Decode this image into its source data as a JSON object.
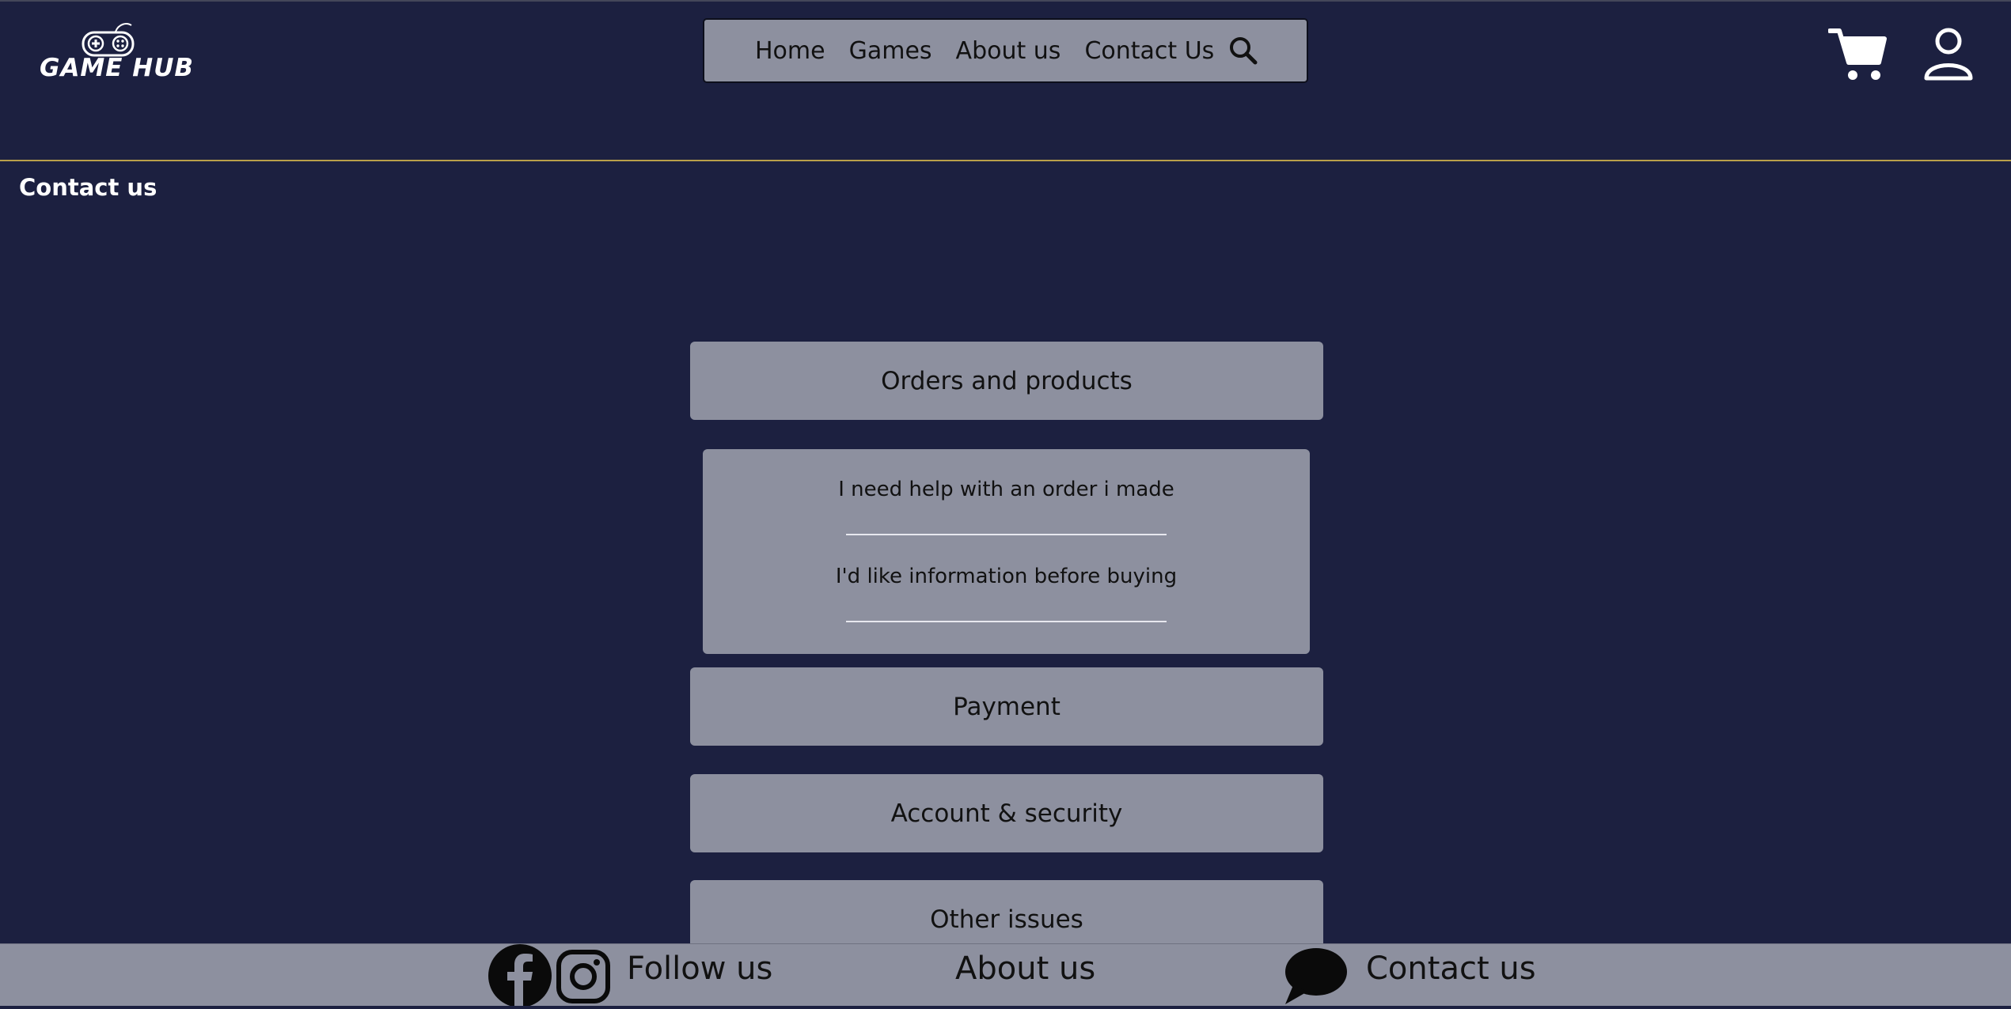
{
  "brand": {
    "name": "GAME HUB"
  },
  "nav": {
    "items": [
      "Home",
      "Games",
      "About us",
      "Contact Us"
    ],
    "search_icon": "search-icon"
  },
  "header_icons": {
    "cart": "cart-icon",
    "account": "user-icon"
  },
  "page": {
    "title": "Contact us"
  },
  "categories": {
    "orders": "Orders and products",
    "orders_sub": [
      "I need help with an order i made",
      "I'd like information before buying"
    ],
    "payment": "Payment",
    "account": "Account & security",
    "other": "Other issues"
  },
  "footer": {
    "follow": "Follow us",
    "about": "About us",
    "contact": "Contact us",
    "icons": [
      "facebook-icon",
      "instagram-icon",
      "chat-bubble-icon"
    ]
  },
  "colors": {
    "background": "#1c2040",
    "panel": "#8d909f",
    "accent_line": "#b9a04a",
    "text_light": "#ffffff",
    "text_dark": "#111111"
  }
}
